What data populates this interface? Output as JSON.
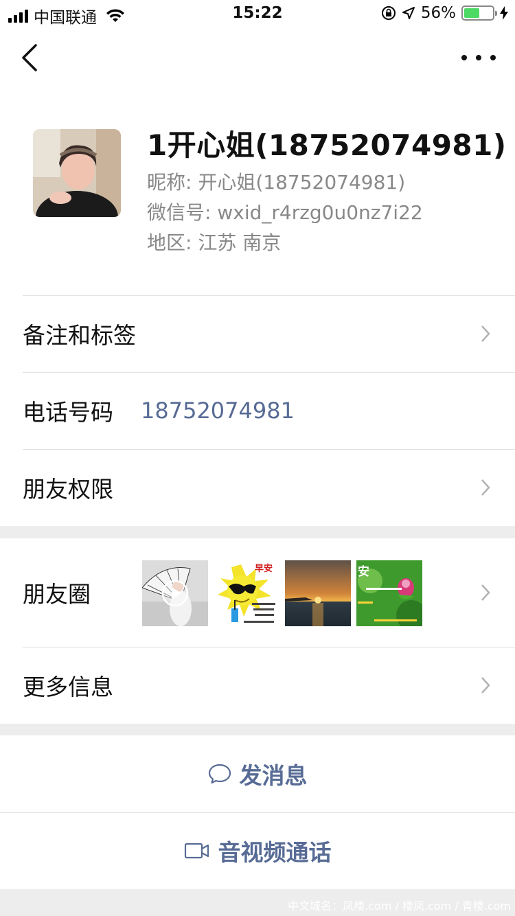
{
  "status_bar": {
    "carrier": "中国联通",
    "time": "15:22",
    "battery": "56%",
    "battery_level": 0.56
  },
  "profile": {
    "display_name": "1开心姐(18752074981)",
    "nickname_label": "昵称:",
    "nickname": "开心姐(18752074981)",
    "wechat_id_label": "微信号:",
    "wechat_id": "wxid_r4rzg0u0nz7i22",
    "region_label": "地区:",
    "region": "江苏 南京"
  },
  "rows": {
    "remarks_tags": "备注和标签",
    "phone_label": "电话号码",
    "phone_value": "18752074981",
    "friend_permissions": "朋友权限",
    "moments": "朋友圈",
    "more_info": "更多信息"
  },
  "moments_thumbs": {
    "t2_caption": "早安",
    "t4_caption": "安"
  },
  "actions": {
    "send_message": "发消息",
    "video_call": "音视频通话"
  },
  "icons": {
    "back": "back-arrow-icon",
    "more": "more-dots-icon",
    "chevron": "chevron-right-icon",
    "chat": "chat-bubble-icon",
    "video": "video-camera-icon"
  },
  "colors": {
    "link": "#576b95",
    "battery": "#4cd964"
  },
  "watermark": "中文域名：凤楼.com / 楼凤.com / 青楼.com"
}
